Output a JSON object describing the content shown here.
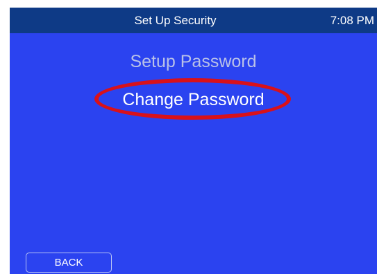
{
  "header": {
    "title": "Set Up Security",
    "clock": "7:08 PM"
  },
  "menu": {
    "items": [
      {
        "label": "Setup Password",
        "state": "dimmed"
      },
      {
        "label": "Change Password",
        "state": "highlighted"
      }
    ]
  },
  "footer": {
    "back_label": "BACK"
  },
  "colors": {
    "screen_background": "#2b43f0",
    "titlebar_background": "#0e3a86",
    "highlight_ring": "#d9111a",
    "dimmed_text": "#b9c1e8"
  }
}
